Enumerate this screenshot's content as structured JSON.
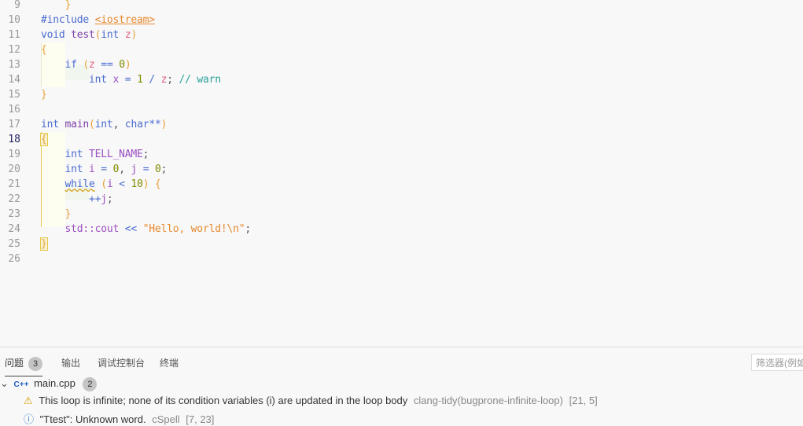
{
  "editor": {
    "current_line": 18,
    "lines": [
      {
        "n": 9,
        "tokens": [
          [
            "    ",
            "pl"
          ],
          [
            "}",
            "br"
          ]
        ]
      },
      {
        "n": 10,
        "tokens": [
          [
            "#include ",
            "op"
          ],
          [
            "<iostream>",
            "st und"
          ]
        ]
      },
      {
        "n": 11,
        "tokens": [
          [
            "void ",
            "kw"
          ],
          [
            "test",
            "fn"
          ],
          [
            "(",
            "br"
          ],
          [
            "int ",
            "kw"
          ],
          [
            "z",
            "pa"
          ],
          [
            ")",
            "br"
          ]
        ]
      },
      {
        "n": 12,
        "tokens": [
          [
            "{",
            "br"
          ]
        ]
      },
      {
        "n": 13,
        "tokens": [
          [
            "    ",
            "pl"
          ],
          [
            "if ",
            "kw"
          ],
          [
            "(",
            "br"
          ],
          [
            "z",
            "pa"
          ],
          [
            " == ",
            "op"
          ],
          [
            "0",
            "nu"
          ],
          [
            ")",
            "br"
          ]
        ]
      },
      {
        "n": 14,
        "tokens": [
          [
            "        ",
            "pl"
          ],
          [
            "int ",
            "kw"
          ],
          [
            "x",
            "va"
          ],
          [
            " = ",
            "op"
          ],
          [
            "1",
            "nu"
          ],
          [
            " / ",
            "op"
          ],
          [
            "z",
            "pa"
          ],
          [
            "; ",
            "pu"
          ],
          [
            "// warn",
            "cm"
          ]
        ]
      },
      {
        "n": 15,
        "tokens": [
          [
            "}",
            "br"
          ]
        ]
      },
      {
        "n": 16,
        "tokens": []
      },
      {
        "n": 17,
        "tokens": [
          [
            "int ",
            "kw"
          ],
          [
            "main",
            "fn"
          ],
          [
            "(",
            "br"
          ],
          [
            "int",
            "kw"
          ],
          [
            ", ",
            "pu"
          ],
          [
            "char",
            "kw"
          ],
          [
            "**",
            "op"
          ],
          [
            ")",
            "br"
          ]
        ]
      },
      {
        "n": 18,
        "tokens": [
          [
            "{",
            "br brbox"
          ]
        ]
      },
      {
        "n": 19,
        "tokens": [
          [
            "    ",
            "pl"
          ],
          [
            "int ",
            "kw"
          ],
          [
            "TELL_NAME",
            "va"
          ],
          [
            ";",
            "pu"
          ]
        ]
      },
      {
        "n": 20,
        "tokens": [
          [
            "    ",
            "pl"
          ],
          [
            "int ",
            "kw"
          ],
          [
            "i",
            "va"
          ],
          [
            " = ",
            "op"
          ],
          [
            "0",
            "nu"
          ],
          [
            ", ",
            "pu"
          ],
          [
            "j",
            "va"
          ],
          [
            " = ",
            "op"
          ],
          [
            "0",
            "nu"
          ],
          [
            ";",
            "pu"
          ]
        ]
      },
      {
        "n": 21,
        "tokens": [
          [
            "    ",
            "pl"
          ],
          [
            "while",
            "kw wavy"
          ],
          [
            " ",
            "pl"
          ],
          [
            "(",
            "br"
          ],
          [
            "i",
            "va"
          ],
          [
            " < ",
            "op"
          ],
          [
            "10",
            "nu"
          ],
          [
            ") ",
            "br"
          ],
          [
            "{",
            "br"
          ]
        ]
      },
      {
        "n": 22,
        "tokens": [
          [
            "        ",
            "pl"
          ],
          [
            "++",
            "op"
          ],
          [
            "j",
            "va"
          ],
          [
            ";",
            "pu"
          ]
        ]
      },
      {
        "n": 23,
        "tokens": [
          [
            "    ",
            "pl"
          ],
          [
            "}",
            "br"
          ]
        ]
      },
      {
        "n": 24,
        "tokens": [
          [
            "    ",
            "pl"
          ],
          [
            "std::cout",
            "va"
          ],
          [
            " << ",
            "op"
          ],
          [
            "\"Hello, world!\\n\"",
            "st"
          ],
          [
            ";",
            "pu"
          ]
        ]
      },
      {
        "n": 25,
        "tokens": [
          [
            "}",
            "br brbox"
          ]
        ]
      },
      {
        "n": 26,
        "tokens": []
      }
    ]
  },
  "panel": {
    "tabs": [
      {
        "label": "问题",
        "badge": "3"
      },
      {
        "label": "输出"
      },
      {
        "label": "调试控制台"
      },
      {
        "label": "终端"
      }
    ],
    "filter_placeholder": "筛选器(例如",
    "file": {
      "name": "main.cpp",
      "icon": "C++",
      "count": "2"
    },
    "problems": [
      {
        "icon": "warning",
        "message": "This loop is infinite; none of its condition variables (i) are updated in the loop body",
        "source": "clang-tidy(bugprone-infinite-loop)",
        "pos": "[21, 5]"
      },
      {
        "icon": "info",
        "message": "\"Ttest\": Unknown word.",
        "source": "cSpell",
        "pos": "[7, 23]"
      }
    ]
  }
}
